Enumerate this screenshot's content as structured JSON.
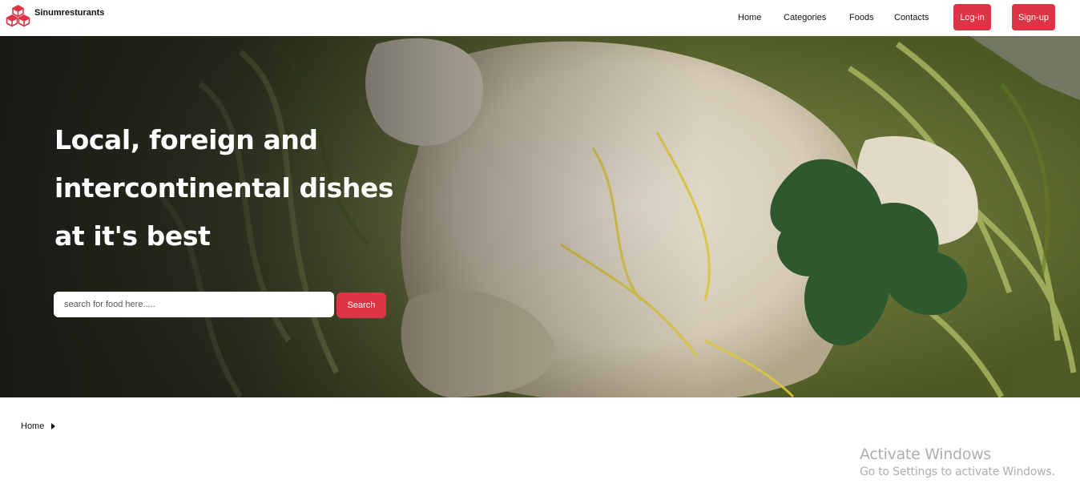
{
  "brand": {
    "name": "Sinumresturants",
    "logo_icon": "cubes-icon",
    "accent_color": "#dc3545"
  },
  "nav": {
    "links": [
      "Home",
      "Categories",
      "Foods",
      "Contacts"
    ],
    "login_label": "Log-in",
    "signup_label": "Sign-up"
  },
  "hero": {
    "headline": "Local, foreign and intercontinental dishes at it's best",
    "search_placeholder": "search for food here.....",
    "search_label": "Search",
    "background": "food-photo"
  },
  "breadcrumb": {
    "home_label": "Home",
    "caret_icon": "caret-right-icon"
  },
  "watermark": {
    "title": "Activate Windows",
    "subtitle": "Go to Settings to activate Windows."
  }
}
